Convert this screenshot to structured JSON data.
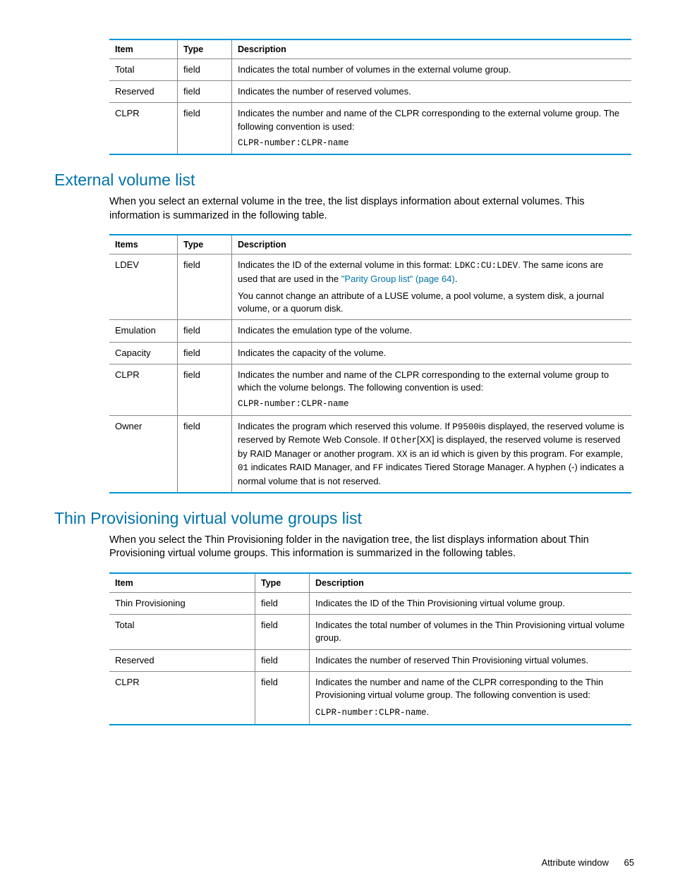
{
  "table1": {
    "headers": [
      "Item",
      "Type",
      "Description"
    ],
    "rows": [
      {
        "item": "Total",
        "type": "field",
        "desc": "Indicates the total number of volumes in the external volume group."
      },
      {
        "item": "Reserved",
        "type": "field",
        "desc": "Indicates the number of reserved volumes."
      },
      {
        "item": "CLPR",
        "type": "field",
        "desc": "Indicates the number and name of the CLPR corresponding to the external volume group. The following convention is used:",
        "code": "CLPR-number:CLPR-name"
      }
    ]
  },
  "section1": {
    "heading": "External volume list",
    "para": "When you select an external volume in the tree, the list displays information about external volumes. This information is summarized in the following table."
  },
  "table2": {
    "headers": [
      "Items",
      "Type",
      "Description"
    ],
    "rows": {
      "ldev": {
        "item": "LDEV",
        "type": "field",
        "d1a": "Indicates the ID of the external volume in this format: ",
        "d1code": "LDKC:CU:LDEV",
        "d1b": ". The same icons are used that are used in the ",
        "d1link": "\"Parity Group list\" (page 64)",
        "d1c": ".",
        "d2": "You cannot change an attribute of a LUSE volume, a pool volume, a system disk, a journal volume, or a quorum disk."
      },
      "emulation": {
        "item": "Emulation",
        "type": "field",
        "desc": "Indicates the emulation type of the volume."
      },
      "capacity": {
        "item": "Capacity",
        "type": "field",
        "desc": "Indicates the capacity of the volume."
      },
      "clpr": {
        "item": "CLPR",
        "type": "field",
        "desc": "Indicates the number and name of the CLPR corresponding to the external volume group to which the volume belongs. The following convention is used:",
        "code": "CLPR-number:CLPR-name"
      },
      "owner": {
        "item": "Owner",
        "type": "field",
        "p1": "Indicates the program which reserved this volume. If ",
        "c1": "P9500",
        "p2": "is displayed, the reserved volume is reserved by Remote Web Console. If ",
        "c2": "Other",
        "p3": "[XX] is displayed, the reserved volume is reserved by RAID Manager or another program. ",
        "c3": "XX",
        "p4": " is an id which is given by this program. For example, ",
        "c4": "01",
        "p5": " indicates RAID Manager, and ",
        "c5": "FF",
        "p6": " indicates Tiered Storage Manager. A hyphen (-) indicates a normal volume that is not reserved."
      }
    }
  },
  "section2": {
    "heading": "Thin Provisioning virtual volume groups list",
    "para": "When you select the Thin Provisioning folder in the navigation tree, the list displays information about Thin Provisioning virtual volume groups. This information is summarized in the following tables."
  },
  "table3": {
    "headers": [
      "Item",
      "Type",
      "Description"
    ],
    "rows": [
      {
        "item": "Thin Provisioning",
        "type": "field",
        "desc": "Indicates the ID of the Thin Provisioning virtual volume group."
      },
      {
        "item": "Total",
        "type": "field",
        "desc": "Indicates the total number of volumes in the Thin Provisioning virtual volume group."
      },
      {
        "item": "Reserved",
        "type": "field",
        "desc": "Indicates the number of reserved Thin Provisioning virtual volumes."
      },
      {
        "item": "CLPR",
        "type": "field",
        "desc": "Indicates the number and name of the CLPR corresponding to the Thin Provisioning virtual volume group. The following convention is used:",
        "code": "CLPR-number:CLPR-name",
        "codetrail": "."
      }
    ]
  },
  "footer": {
    "title": "Attribute window",
    "page": "65"
  }
}
